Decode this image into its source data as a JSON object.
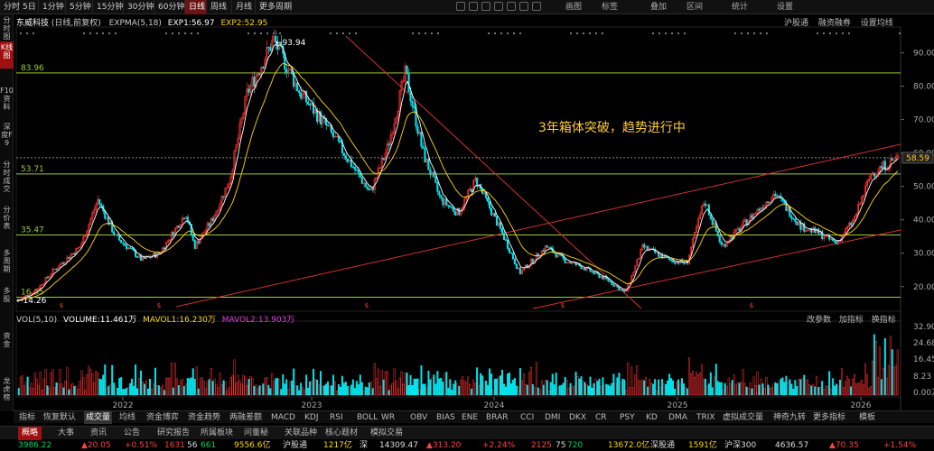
{
  "toolbar": {
    "periods": [
      "分时",
      "5日",
      "1分钟",
      "5分钟",
      "15分钟",
      "30分钟",
      "60分钟",
      "日线",
      "周线",
      "月线",
      "更多周期"
    ],
    "active_index": 7,
    "right_items": [
      "画图",
      "标签",
      "叠加",
      "区间",
      "统计",
      "设置"
    ]
  },
  "sidebar": {
    "items": [
      {
        "label": "分时图",
        "active": false
      },
      {
        "label": "K线图",
        "active": true
      },
      {
        "label": "F10资料",
        "active": false
      },
      {
        "label": "深度F9",
        "active": false
      },
      {
        "label": "分时成交",
        "active": false
      },
      {
        "label": "分价表",
        "active": false
      },
      {
        "label": "多周期",
        "active": false
      },
      {
        "label": "多股",
        "active": false
      },
      {
        "label": "资金",
        "active": false
      },
      {
        "label": "龙虎榜",
        "active": false
      }
    ]
  },
  "header": {
    "stock_name": "东威科技",
    "adjust": "(日线,前复权)",
    "indicator": "EXPMA(5,18)",
    "exp1": "EXP1:56.97",
    "exp2": "EXP2:52.95",
    "right_links": [
      "沪股通",
      "融资融券",
      "设置均线"
    ]
  },
  "price_axis": {
    "ticks": [
      "90.00",
      "80.00",
      "70.00",
      "60.00",
      "50.00",
      "40.00",
      "30.00",
      "20.00"
    ],
    "current": "58.59"
  },
  "levels": {
    "high_marker": "93.94",
    "low_marker": "14.26",
    "lines": [
      "83.96",
      "53.71",
      "35.47",
      "16.85"
    ]
  },
  "annotation": "3年箱体突破，趋势进行中",
  "volume": {
    "header": "VOL(5,10)",
    "volume": "VOLUME:11.461万",
    "mavol1": "MAVOL1:16.230万",
    "mavol2": "MAVOL2:13.903万",
    "right_links": [
      "改参数",
      "加指标",
      "换指标"
    ],
    "ticks": [
      "32.90",
      "24.68",
      "16.45",
      "8.23",
      "0.00万"
    ]
  },
  "x_axis": {
    "years": [
      "2022",
      "2023",
      "2024",
      "2025",
      "2026"
    ]
  },
  "indicators": {
    "items": [
      "指标",
      "恢复默认",
      "成交量",
      "均线",
      "资金博弈",
      "资金趋势",
      "两融差额",
      "MACD",
      "KDJ",
      "RSI",
      "BOLL",
      "WR",
      "OBV",
      "BIAS",
      "ENE",
      "BRAR",
      "CCI",
      "DMI",
      "DKX",
      "CR",
      "PSY",
      "KD",
      "DMA",
      "TRIX",
      "虚拟成交量",
      "神奇九转",
      "更多指标",
      "模板"
    ],
    "active": "成交量"
  },
  "bottom_tabs": {
    "items": [
      "概略",
      "大事",
      "资讯",
      "公告",
      "研究报告",
      "所属板块",
      "问董秘",
      "关联品种",
      "核心题材",
      "模拟交易"
    ],
    "active_index": 0
  },
  "ticker": {
    "items": [
      {
        "text": "3986.22",
        "cls": "dn"
      },
      {
        "text": "▲20.05",
        "cls": "up"
      },
      {
        "text": "+0.51%",
        "cls": "up"
      },
      {
        "text": "1631",
        "cls": "up"
      },
      {
        "text": "56",
        "cls": "wh"
      },
      {
        "text": "661",
        "cls": "dn"
      },
      {
        "text": "9556.6亿",
        "cls": "yl"
      },
      {
        "text": "沪股通",
        "cls": "wh"
      },
      {
        "text": "1217亿",
        "cls": "yl"
      },
      {
        "text": "深",
        "cls": "wh"
      },
      {
        "text": "14309.47",
        "cls": "wh"
      },
      {
        "text": "▲313.20",
        "cls": "up"
      },
      {
        "text": "+2.24%",
        "cls": "up"
      },
      {
        "text": "2125",
        "cls": "up"
      },
      {
        "text": "75",
        "cls": "wh"
      },
      {
        "text": "720",
        "cls": "dn"
      },
      {
        "text": "13672.0亿",
        "cls": "yl"
      },
      {
        "text": "深股通",
        "cls": "wh"
      },
      {
        "text": "1591亿",
        "cls": "yl"
      },
      {
        "text": "沪深300",
        "cls": "wh"
      },
      {
        "text": "4636.57",
        "cls": "wh"
      },
      {
        "text": "▲70.35",
        "cls": "up"
      },
      {
        "text": "+1.54%",
        "cls": "up"
      }
    ]
  },
  "colors": {
    "up": "#ff3232",
    "down": "#00e5ee",
    "exp1": "#ffffff",
    "exp2": "#ffd700",
    "level": "#9acd32",
    "trend": "#d43030",
    "annotation": "#ffcc33",
    "mavol2": "#e040e0"
  },
  "chart_data": {
    "type": "candlestick",
    "x_range": [
      "2021-09",
      "2026-03"
    ],
    "ylim": [
      14,
      95
    ],
    "price_path": [
      [
        0,
        16
      ],
      [
        0.02,
        19
      ],
      [
        0.04,
        25
      ],
      [
        0.07,
        32
      ],
      [
        0.09,
        46
      ],
      [
        0.11,
        35
      ],
      [
        0.14,
        28
      ],
      [
        0.16,
        30
      ],
      [
        0.19,
        42
      ],
      [
        0.2,
        32
      ],
      [
        0.22,
        40
      ],
      [
        0.24,
        52
      ],
      [
        0.26,
        78
      ],
      [
        0.29,
        93.94
      ],
      [
        0.32,
        78
      ],
      [
        0.35,
        68
      ],
      [
        0.38,
        56
      ],
      [
        0.4,
        48
      ],
      [
        0.42,
        62
      ],
      [
        0.44,
        84
      ],
      [
        0.46,
        60
      ],
      [
        0.48,
        46
      ],
      [
        0.5,
        42
      ],
      [
        0.52,
        52
      ],
      [
        0.55,
        36
      ],
      [
        0.57,
        24
      ],
      [
        0.6,
        32
      ],
      [
        0.62,
        28
      ],
      [
        0.64,
        26
      ],
      [
        0.67,
        22
      ],
      [
        0.69,
        18
      ],
      [
        0.71,
        32
      ],
      [
        0.74,
        28
      ],
      [
        0.76,
        27
      ],
      [
        0.78,
        46
      ],
      [
        0.8,
        32
      ],
      [
        0.83,
        40
      ],
      [
        0.86,
        48
      ],
      [
        0.89,
        38
      ],
      [
        0.91,
        36
      ],
      [
        0.93,
        33
      ],
      [
        0.95,
        40
      ],
      [
        0.97,
        54
      ],
      [
        1.0,
        58.59
      ]
    ],
    "levels": [
      83.96,
      53.71,
      35.47,
      16.85
    ],
    "high": 93.94,
    "low": 14.26
  }
}
